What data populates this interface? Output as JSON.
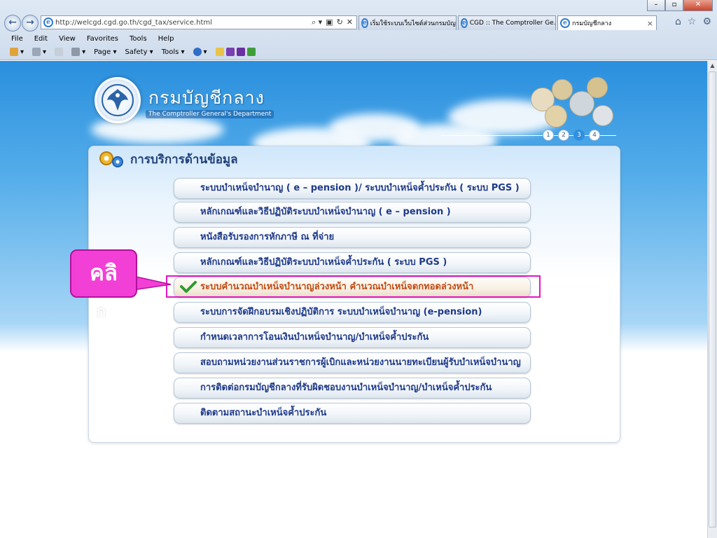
{
  "browser": {
    "url": "http://welcgd.cgd.go.th/cgd_tax/service.html",
    "tabs": [
      {
        "label": "เริ่มใช้ระบบเว็บไซต์ส่วนกรมบัญชี...",
        "active": false
      },
      {
        "label": "CGD :: The Comptroller Ge...",
        "active": false
      },
      {
        "label": "กรมบัญชีกลาง",
        "active": true
      }
    ],
    "tab_close": "×",
    "window_buttons": {
      "minimize": "–",
      "restore": "▫",
      "close": "✕"
    },
    "nav": {
      "back": "←",
      "forward": "→"
    },
    "address_tools": [
      "⌕ ▾",
      "▣",
      "↻",
      "✕"
    ],
    "right_icons": [
      "⌂",
      "☆",
      "⚙"
    ],
    "menu": [
      "File",
      "Edit",
      "View",
      "Favorites",
      "Tools",
      "Help"
    ],
    "commands": [
      "Page ▾",
      "Safety ▾",
      "Tools ▾"
    ]
  },
  "site": {
    "title": "กรมบัญชีกลาง",
    "subtitle": "The Comptroller General's Department",
    "page_numbers": [
      "1",
      "2",
      "3",
      "4"
    ],
    "current_page": "3"
  },
  "panel": {
    "title": "การบริการด้านข้อมูล",
    "services": [
      "ระบบบำเหน็จบำนาญ ( e – pension )/ ระบบบำเหน็จค้ำประกัน ( ระบบ PGS )",
      "หลักเกณฑ์และวิธีปฏิบัติระบบบำเหน็จบำนาญ ( e – pension )",
      "หนังสือรับรองการหักภาษี ณ ที่จ่าย",
      "หลักเกณฑ์และวิธีปฏิบัติระบบบำเหน็จค้ำประกัน ( ระบบ PGS )",
      "ระบบคำนวณบำเหน็จบำนาญล่วงหน้า คำนวณบำเหน็จตกทอดล่วงหน้า",
      "ระบบการจัดฝึกอบรมเชิงปฏิบัติการ ระบบบำเหน็จบำนาญ (e-pension)",
      "กำหนดเวลาการโอนเงินบำเหน็จบำนาญ/บำเหน็จค้ำประกัน",
      "สอบถามหน่วยงานส่วนราชการผู้เบิกและหน่วยงานนายทะเบียนผู้รับบำเหน็จบำนาญ",
      "การติดต่อกรมบัญชีกลางที่รับผิดชอบงานบำเหน็จบำนาญ/บำเหน็จค้ำประกัน",
      "ติดตามสถานะบำเหน็จค้ำประกัน"
    ],
    "selected_index": 4
  },
  "annotation": {
    "callout_text": "คลิ",
    "callout_overflow": "ก",
    "highlight_color": "#e316c6",
    "callout_color": "#f23fd6"
  },
  "colors": {
    "service_text": "#1e3a8a",
    "selected_text": "#c24b14",
    "sky": "#2a8fde"
  }
}
